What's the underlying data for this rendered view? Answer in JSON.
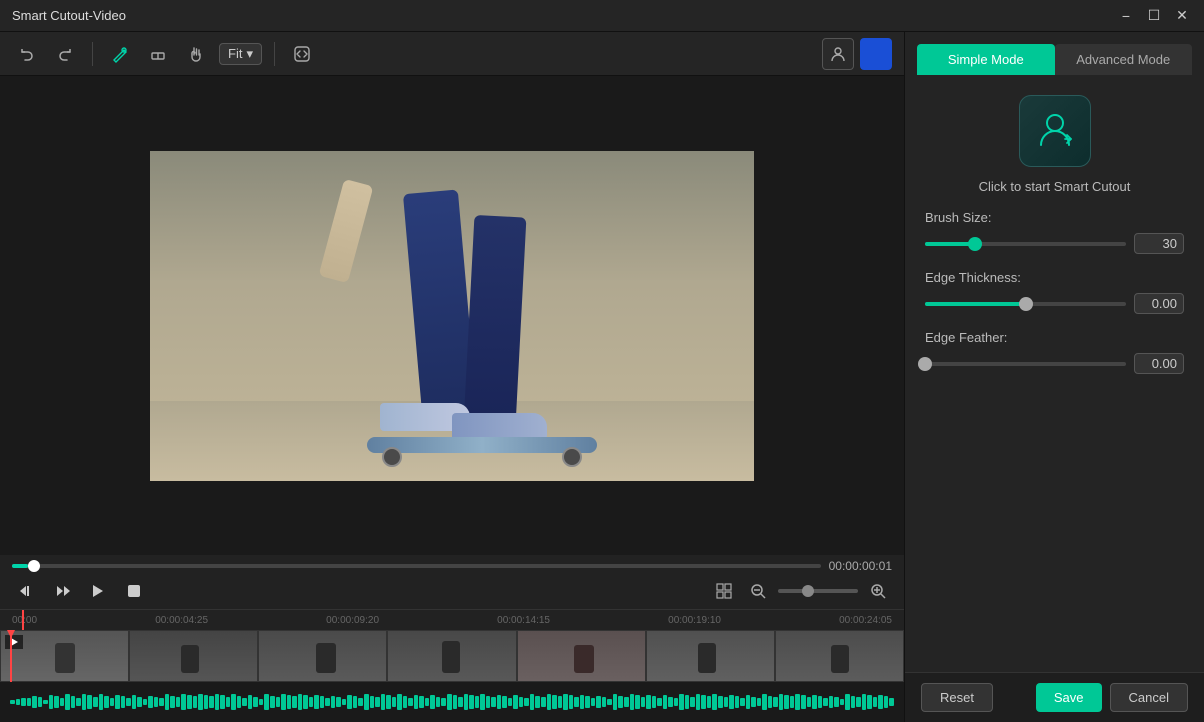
{
  "window": {
    "title": "Smart Cutout-Video"
  },
  "toolbar": {
    "fit_label": "Fit",
    "undo_label": "↩",
    "redo_label": "↪"
  },
  "video": {
    "time_display": "00:00:00:01"
  },
  "timeline": {
    "marks": [
      "00:00",
      "00:00:04:25",
      "00:00:09:20",
      "00:00:14:15",
      "00:00:19:10",
      "00:00:24:05"
    ]
  },
  "right_panel": {
    "simple_mode_label": "Simple Mode",
    "advanced_mode_label": "Advanced Mode",
    "cutout_label": "Click to start Smart Cutout",
    "brush_size_label": "Brush Size:",
    "brush_size_value": "30",
    "brush_size_percent": 25,
    "edge_thickness_label": "Edge Thickness:",
    "edge_thickness_value": "0.00",
    "edge_thickness_percent": 50,
    "edge_feather_label": "Edge Feather:",
    "edge_feather_value": "0.00",
    "edge_feather_percent": 0
  },
  "footer": {
    "reset_label": "Reset",
    "save_label": "Save",
    "cancel_label": "Cancel"
  }
}
